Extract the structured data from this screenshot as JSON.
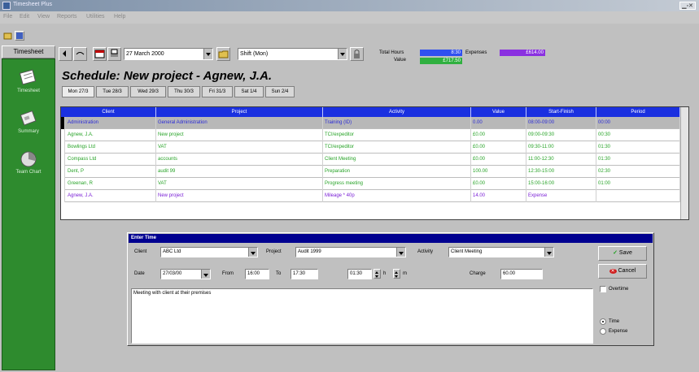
{
  "window": {
    "title": "Timesheet Plus"
  },
  "menu": [
    "File",
    "Edit",
    "View",
    "Reports",
    "Utilities",
    "Help"
  ],
  "sidebar": {
    "header": "Timesheet",
    "items": [
      {
        "label": "Timesheet",
        "icon": "timesheet-icon"
      },
      {
        "label": "Summary",
        "icon": "summary-icon"
      },
      {
        "label": "Team Chart",
        "icon": "team-chart-icon"
      }
    ]
  },
  "toolbar": {
    "date_value": "27   March   2000",
    "period_value": "Shift (Mon)"
  },
  "totals": {
    "total_hours_label": "Total Hours",
    "total_hours_value": "8:30",
    "value_label": "Value",
    "value_value": "£717.50",
    "expenses_label": "Expenses",
    "expenses_value": "£614.00"
  },
  "schedule_title": "Schedule: New project - Agnew, J.A.",
  "day_tabs": [
    "Mon 27/3",
    "Tue 28/3",
    "Wed 29/3",
    "Thu 30/3",
    "Fri 31/3",
    "Sat 1/4",
    "Sun 2/4"
  ],
  "grid": {
    "columns": [
      "Client",
      "Project",
      "Activity",
      "Value",
      "Start-Finish",
      "Period"
    ],
    "rows": [
      {
        "client": "Administration",
        "project": "General Administration",
        "activity": "Training (ID)",
        "value": "0.00",
        "start_finish": "08:00-09:00",
        "period": "00:00",
        "style": "sel"
      },
      {
        "client": "Agnew, J.A.",
        "project": "New project",
        "activity": "TCI/expeditor",
        "value": "£0.00",
        "start_finish": "09:00-09:30",
        "period": "00:30",
        "style": ""
      },
      {
        "client": "Bowlings Ltd",
        "project": "VAT",
        "activity": "TCI/expeditor",
        "value": "£0.00",
        "start_finish": "09:30-11:00",
        "period": "01:30",
        "style": ""
      },
      {
        "client": "Compass Ltd",
        "project": "accounts",
        "activity": "Client Meeting",
        "value": "£0.00",
        "start_finish": "11:00-12:30",
        "period": "01:30",
        "style": ""
      },
      {
        "client": "Dent, P",
        "project": "audit 99",
        "activity": "Preparation",
        "value": "100.00",
        "start_finish": "12:30-15:00",
        "period": "02:30",
        "style": ""
      },
      {
        "client": "Greenan, R",
        "project": "VAT",
        "activity": "Progress meeting",
        "value": "£0.00",
        "start_finish": "15:00-16:00",
        "period": "01:00",
        "style": ""
      },
      {
        "client": "Agnew, J.A.",
        "project": "New project",
        "activity": "Mileage * 40p",
        "value": "14.00",
        "start_finish": "Expense",
        "period": "",
        "style": "exp"
      }
    ]
  },
  "dialog": {
    "title": "Enter Time",
    "client_label": "Client",
    "client_value": "ABC Ltd",
    "project_label": "Project",
    "project_value": "Audit 1999",
    "activity_label": "Activity",
    "activity_value": "Client Meeting",
    "date_label": "Date",
    "date_value": "27/03/00",
    "from_label": "From",
    "from_value": "16:00",
    "to_label": "To",
    "to_value": "17:30",
    "period_value": "01:30",
    "h_label": "h",
    "m_label": "m",
    "charge_label": "Charge",
    "charge_value": "60.00",
    "notes": "Meeting with client at their premises",
    "save_label": "Save",
    "cancel_label": "Cancel",
    "overtime_label": "Overtime",
    "time_label": "Time",
    "expense_label": "Expense"
  }
}
